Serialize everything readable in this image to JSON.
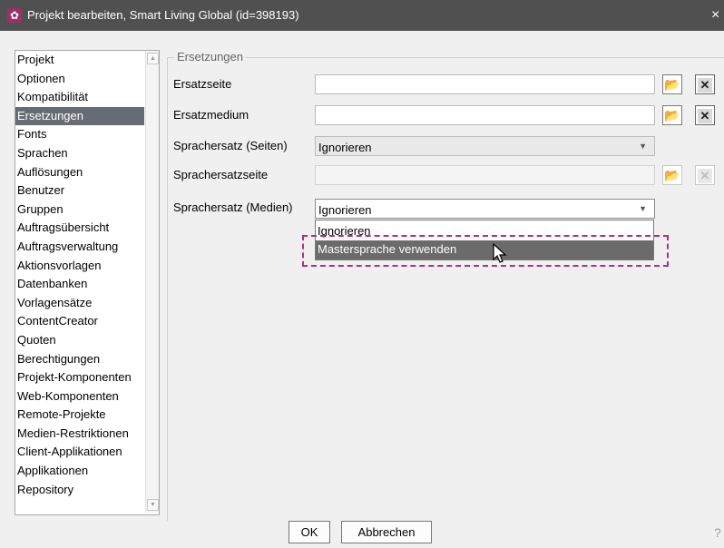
{
  "window": {
    "title": "Projekt bearbeiten, Smart Living Global (id=398193)",
    "close_glyph": "×"
  },
  "nav": {
    "items": [
      {
        "label": "Projekt"
      },
      {
        "label": "Optionen"
      },
      {
        "label": "Kompatibilität"
      },
      {
        "label": "Ersetzungen",
        "selected": true
      },
      {
        "label": "Fonts"
      },
      {
        "label": "Sprachen"
      },
      {
        "label": "Auflösungen"
      },
      {
        "label": "Benutzer"
      },
      {
        "label": "Gruppen"
      },
      {
        "label": "Auftragsübersicht"
      },
      {
        "label": "Auftragsverwaltung"
      },
      {
        "label": "Aktionsvorlagen"
      },
      {
        "label": "Datenbanken"
      },
      {
        "label": "Vorlagensätze"
      },
      {
        "label": "ContentCreator"
      },
      {
        "label": "Quoten"
      },
      {
        "label": "Berechtigungen"
      },
      {
        "label": "Projekt-Komponenten"
      },
      {
        "label": "Web-Komponenten"
      },
      {
        "label": "Remote-Projekte"
      },
      {
        "label": "Medien-Restriktionen"
      },
      {
        "label": "Client-Applikationen"
      },
      {
        "label": "Applikationen"
      },
      {
        "label": "Repository"
      }
    ]
  },
  "section": {
    "title": "Ersetzungen",
    "fields": {
      "ersatzseite": {
        "label": "Ersatzseite",
        "value": ""
      },
      "ersatzmedium": {
        "label": "Ersatzmedium",
        "value": ""
      },
      "sprachersatz_seiten": {
        "label": "Sprachersatz (Seiten)",
        "value": "Ignorieren"
      },
      "sprachersatzseite": {
        "label": "Sprachersatzseite",
        "value": ""
      },
      "sprachersatz_medien": {
        "label": "Sprachersatz (Medien)",
        "value": "Ignorieren"
      }
    },
    "dropdown_options": [
      "Ignorieren",
      "Mastersprache verwenden"
    ],
    "highlighted_option": "Mastersprache verwenden"
  },
  "icons": {
    "browse": "📂",
    "clear": "✕",
    "dropdown": "▼"
  },
  "footer": {
    "ok_label": "OK",
    "cancel_label": "Abbrechen",
    "help_glyph": "?"
  },
  "colors": {
    "titlebar": "#505050",
    "selected_nav": "#666b74",
    "annotation": "#b0307c",
    "app_icon": "#9b2f6b"
  }
}
